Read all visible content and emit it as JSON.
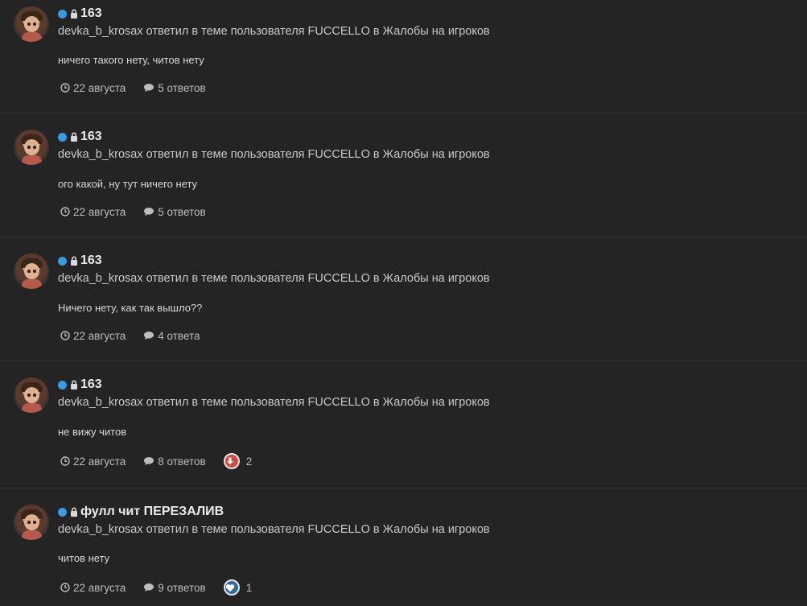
{
  "feed": {
    "items": [
      {
        "title": "163",
        "meta": "devka_b_krosax ответил в теме пользователя FUCCELLO в Жалобы на игроков",
        "snippet": "ничего такого нету, читов нету",
        "date": "22 августа",
        "replies": "5 ответов",
        "reaction": null
      },
      {
        "title": "163",
        "meta": "devka_b_krosax ответил в теме пользователя FUCCELLO в Жалобы на игроков",
        "snippet": "ого какой, ну тут ничего нету",
        "date": "22 августа",
        "replies": "5 ответов",
        "reaction": null
      },
      {
        "title": "163",
        "meta": "devka_b_krosax ответил в теме пользователя FUCCELLO в Жалобы на игроков",
        "snippet": "Ничего нету, как так вышло??",
        "date": "22 августа",
        "replies": "4 ответа",
        "reaction": null
      },
      {
        "title": "163",
        "meta": "devka_b_krosax ответил в теме пользователя FUCCELLO в Жалобы на игроков",
        "snippet": "не вижу читов",
        "date": "22 августа",
        "replies": "8 ответов",
        "reaction": {
          "type": "downvote",
          "count": "2",
          "color": "#d04a48"
        }
      },
      {
        "title": "фулл чит ПЕРЕЗАЛИВ",
        "meta": "devka_b_krosax ответил в теме пользователя FUCCELLO в Жалобы на игроков",
        "snippet": "читов нету",
        "date": "22 августа",
        "replies": "9 ответов",
        "reaction": {
          "type": "like-heart",
          "count": "1",
          "color": "#2d6c9c"
        }
      }
    ]
  },
  "colors": {
    "background": "#242424",
    "divider": "#353535",
    "unread_dot": "#3b9ae0",
    "text": "#d6d6d6"
  },
  "icons": {
    "unread": "unread-dot-icon",
    "locked": "lock-icon",
    "date": "clock-icon",
    "replies": "comment-icon"
  }
}
